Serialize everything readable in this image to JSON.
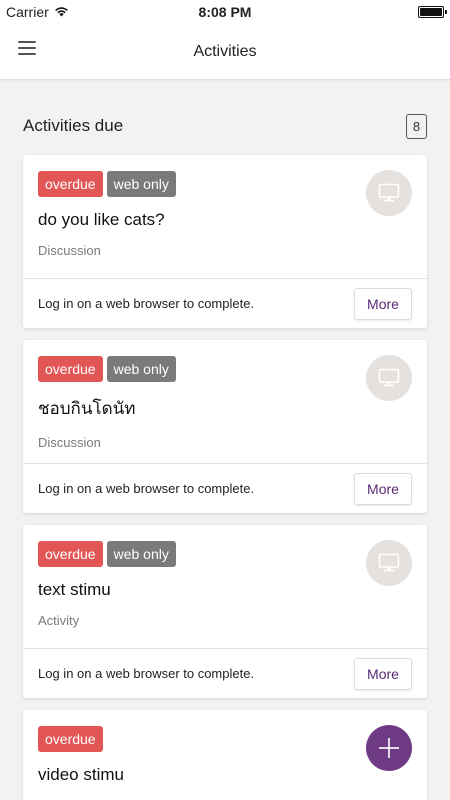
{
  "status_bar": {
    "carrier": "Carrier",
    "time": "8:08 PM"
  },
  "nav": {
    "title": "Activities"
  },
  "section": {
    "title": "Activities due",
    "count": "8"
  },
  "cards": [
    {
      "tags": [
        "overdue",
        "web only"
      ],
      "name": "do you like cats?",
      "type": "Discussion",
      "message": "Log in on a web browser to complete.",
      "action": "More",
      "icon": "monitor-icon"
    },
    {
      "tags": [
        "overdue",
        "web only"
      ],
      "name": "ชอบกินโดนัท",
      "type": "Discussion",
      "message": "Log in on a web browser to complete.",
      "action": "More",
      "icon": "monitor-icon"
    },
    {
      "tags": [
        "overdue",
        "web only"
      ],
      "name": "text stimu",
      "type": "Activity",
      "message": "Log in on a web browser to complete.",
      "action": "More",
      "icon": "monitor-icon"
    },
    {
      "tags": [
        "overdue"
      ],
      "name": "video stimu",
      "icon": "plus-icon"
    }
  ],
  "colors": {
    "overdue": "#e25656",
    "web_only": "#7a7a7a",
    "accent": "#6e3a84",
    "more_text": "#5a2a73"
  }
}
